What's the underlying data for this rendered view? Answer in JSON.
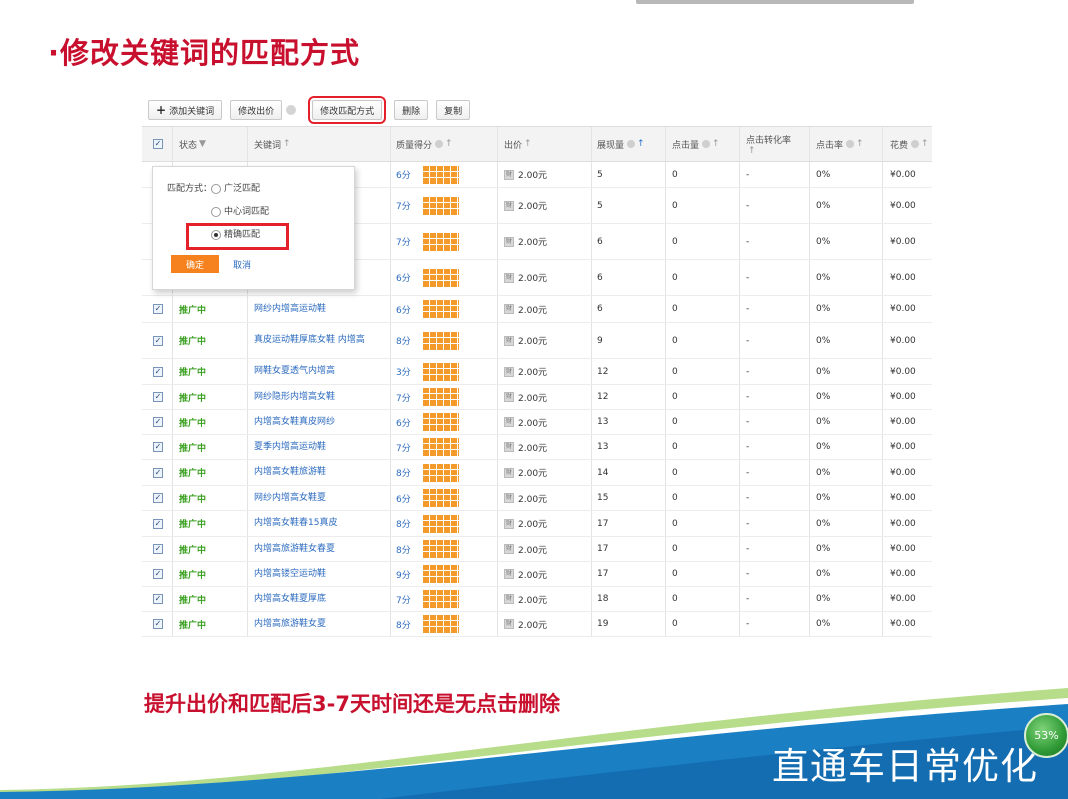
{
  "slide": {
    "title": "·修改关键词的匹配方式",
    "bottom_note": "提升出价和匹配后3-7天时间还是无点击删除",
    "footer_title": "直通车日常优化",
    "progress_label": "53%",
    "progress_percent": 53
  },
  "toolbar": {
    "add_keyword": "添加关键词",
    "modify_bid": "修改出价",
    "modify_match": "修改匹配方式",
    "delete": "删除",
    "copy": "复制"
  },
  "table": {
    "headers": {
      "status": "状态",
      "keyword": "关键词",
      "quality": "质量得分",
      "bid": "出价",
      "impressions": "展现量",
      "clicks": "点击量",
      "conversion": "点击转化率",
      "ctr": "点击率",
      "cost": "花费"
    },
    "rows": [
      {
        "checked": false,
        "status": "",
        "keyword": "",
        "score": "6分",
        "bid": "2.00元",
        "impressions": "5",
        "clicks": "0",
        "conversion": "-",
        "ctr": "0%",
        "cost": "¥0.00"
      },
      {
        "checked": false,
        "status": "",
        "keyword": "",
        "score": "7分",
        "bid": "2.00元",
        "impressions": "5",
        "clicks": "0",
        "conversion": "-",
        "ctr": "0%",
        "cost": "¥0.00"
      },
      {
        "checked": false,
        "status": "",
        "keyword": "",
        "score": "7分",
        "bid": "2.00元",
        "impressions": "6",
        "clicks": "0",
        "conversion": "-",
        "ctr": "0%",
        "cost": "¥0.00"
      },
      {
        "checked": false,
        "status": "",
        "keyword": "休闲旅游鞋",
        "score": "6分",
        "bid": "2.00元",
        "impressions": "6",
        "clicks": "0",
        "conversion": "-",
        "ctr": "0%",
        "cost": "¥0.00"
      },
      {
        "checked": true,
        "status": "推广中",
        "keyword": "网纱内增高运动鞋",
        "score": "6分",
        "bid": "2.00元",
        "impressions": "6",
        "clicks": "0",
        "conversion": "-",
        "ctr": "0%",
        "cost": "¥0.00"
      },
      {
        "checked": true,
        "status": "推广中",
        "keyword": "真皮运动鞋厚底女鞋 内增高",
        "score": "8分",
        "bid": "2.00元",
        "impressions": "9",
        "clicks": "0",
        "conversion": "-",
        "ctr": "0%",
        "cost": "¥0.00"
      },
      {
        "checked": true,
        "status": "推广中",
        "keyword": "网鞋女夏透气内增高",
        "score": "3分",
        "bid": "2.00元",
        "impressions": "12",
        "clicks": "0",
        "conversion": "-",
        "ctr": "0%",
        "cost": "¥0.00"
      },
      {
        "checked": true,
        "status": "推广中",
        "keyword": "网纱隐形内增高女鞋",
        "score": "7分",
        "bid": "2.00元",
        "impressions": "12",
        "clicks": "0",
        "conversion": "-",
        "ctr": "0%",
        "cost": "¥0.00"
      },
      {
        "checked": true,
        "status": "推广中",
        "keyword": "内增高女鞋真皮网纱",
        "score": "6分",
        "bid": "2.00元",
        "impressions": "13",
        "clicks": "0",
        "conversion": "-",
        "ctr": "0%",
        "cost": "¥0.00"
      },
      {
        "checked": true,
        "status": "推广中",
        "keyword": "夏季内增高运动鞋",
        "score": "7分",
        "bid": "2.00元",
        "impressions": "13",
        "clicks": "0",
        "conversion": "-",
        "ctr": "0%",
        "cost": "¥0.00"
      },
      {
        "checked": true,
        "status": "推广中",
        "keyword": "内增高女鞋旅游鞋",
        "score": "8分",
        "bid": "2.00元",
        "impressions": "14",
        "clicks": "0",
        "conversion": "-",
        "ctr": "0%",
        "cost": "¥0.00"
      },
      {
        "checked": true,
        "status": "推广中",
        "keyword": "网纱内增高女鞋夏",
        "score": "6分",
        "bid": "2.00元",
        "impressions": "15",
        "clicks": "0",
        "conversion": "-",
        "ctr": "0%",
        "cost": "¥0.00"
      },
      {
        "checked": true,
        "status": "推广中",
        "keyword": "内增高女鞋春15真皮",
        "score": "8分",
        "bid": "2.00元",
        "impressions": "17",
        "clicks": "0",
        "conversion": "-",
        "ctr": "0%",
        "cost": "¥0.00"
      },
      {
        "checked": true,
        "status": "推广中",
        "keyword": "内增高旅游鞋女春夏",
        "score": "8分",
        "bid": "2.00元",
        "impressions": "17",
        "clicks": "0",
        "conversion": "-",
        "ctr": "0%",
        "cost": "¥0.00"
      },
      {
        "checked": true,
        "status": "推广中",
        "keyword": "内增高镂空运动鞋",
        "score": "9分",
        "bid": "2.00元",
        "impressions": "17",
        "clicks": "0",
        "conversion": "-",
        "ctr": "0%",
        "cost": "¥0.00"
      },
      {
        "checked": true,
        "status": "推广中",
        "keyword": "内增高女鞋夏厚底",
        "score": "7分",
        "bid": "2.00元",
        "impressions": "18",
        "clicks": "0",
        "conversion": "-",
        "ctr": "0%",
        "cost": "¥0.00"
      },
      {
        "checked": true,
        "status": "推广中",
        "keyword": "内增高旅游鞋女夏",
        "score": "8分",
        "bid": "2.00元",
        "impressions": "19",
        "clicks": "0",
        "conversion": "-",
        "ctr": "0%",
        "cost": "¥0.00"
      }
    ]
  },
  "popover": {
    "label": "匹配方式：",
    "options": [
      "广泛匹配",
      "中心词匹配",
      "精确匹配"
    ],
    "selected_index": 2,
    "confirm": "确定",
    "cancel": "取消"
  },
  "colors": {
    "title_red": "#c8102e",
    "highlight_red": "#e4202a",
    "status_green": "#3aa020",
    "link_blue": "#2c6bbf",
    "orange": "#f5821f",
    "wave_blue": "#1b7fc4"
  }
}
